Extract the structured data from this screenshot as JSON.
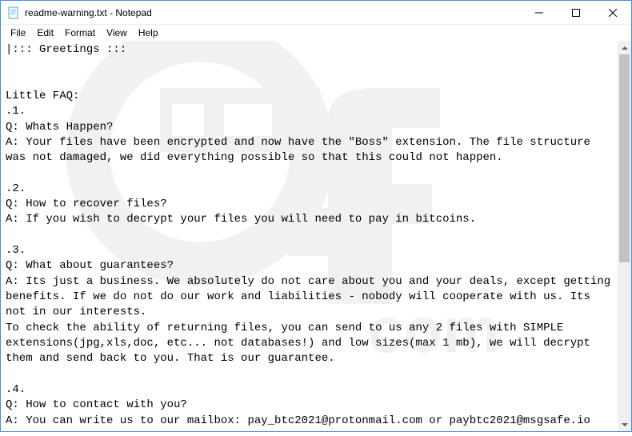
{
  "window": {
    "title": "readme-warning.txt - Notepad"
  },
  "menu": {
    "file": "File",
    "edit": "Edit",
    "format": "Format",
    "view": "View",
    "help": "Help"
  },
  "document": {
    "text": "|::: Greetings :::\n\n\nLittle FAQ:\n.1.\nQ: Whats Happen?\nA: Your files have been encrypted and now have the \"Boss\" extension. The file structure was not damaged, we did everything possible so that this could not happen.\n\n.2.\nQ: How to recover files?\nA: If you wish to decrypt your files you will need to pay in bitcoins.\n\n.3.\nQ: What about guarantees?\nA: Its just a business. We absolutely do not care about you and your deals, except getting benefits. If we do not do our work and liabilities - nobody will cooperate with us. Its not in our interests.\nTo check the ability of returning files, you can send to us any 2 files with SIMPLE extensions(jpg,xls,doc, etc... not databases!) and low sizes(max 1 mb), we will decrypt them and send back to you. That is our guarantee.\n\n.4.\nQ: How to contact with you?\nA: You can write us to our mailbox: pay_btc2021@protonmail.com or paybtc2021@msgsafe.io"
  }
}
